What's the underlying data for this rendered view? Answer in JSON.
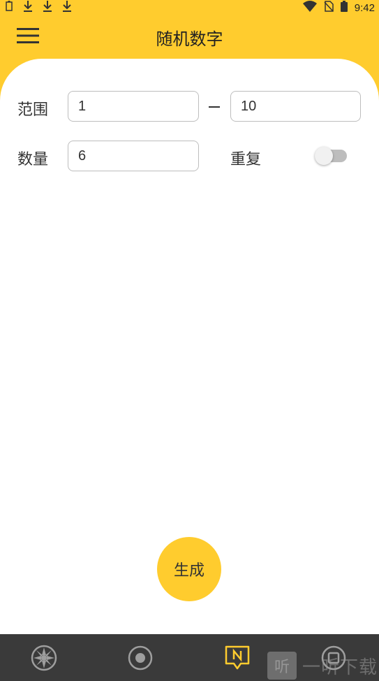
{
  "status_bar": {
    "time": "9:42",
    "left_icons": [
      "clipboard-icon",
      "download-icon",
      "download-icon",
      "download-icon"
    ],
    "right_icons": [
      "wifi-icon",
      "no-sim-icon",
      "battery-icon"
    ]
  },
  "app_bar": {
    "title": "随机数字",
    "menu_icon": "hamburger-menu-icon"
  },
  "form": {
    "range_label": "范围",
    "range_min_value": "1",
    "range_max_value": "10",
    "count_label": "数量",
    "count_value": "6",
    "repeat_label": "重复",
    "repeat_enabled": false
  },
  "generate_button": {
    "label": "生成"
  },
  "bottom_nav": {
    "items": [
      {
        "icon": "wheel-icon"
      },
      {
        "icon": "record-icon"
      },
      {
        "icon": "note-n-icon",
        "active": true
      },
      {
        "icon": "stop-icon"
      }
    ]
  },
  "watermark": {
    "box_char": "听",
    "text": "一听下载"
  },
  "colors": {
    "accent": "#FFCC2E",
    "nav_background": "#3a3a3a",
    "background": "#ffffff"
  }
}
